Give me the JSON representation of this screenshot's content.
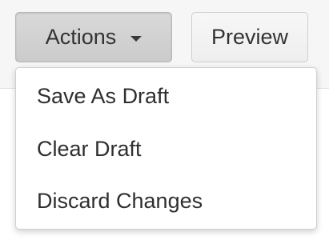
{
  "toolbar": {
    "actions_label": "Actions",
    "preview_label": "Preview",
    "caret_icon": "caret-down-icon"
  },
  "actions_menu": {
    "items": [
      {
        "label": "Save As Draft"
      },
      {
        "label": "Clear Draft"
      },
      {
        "label": "Discard Changes"
      }
    ]
  }
}
